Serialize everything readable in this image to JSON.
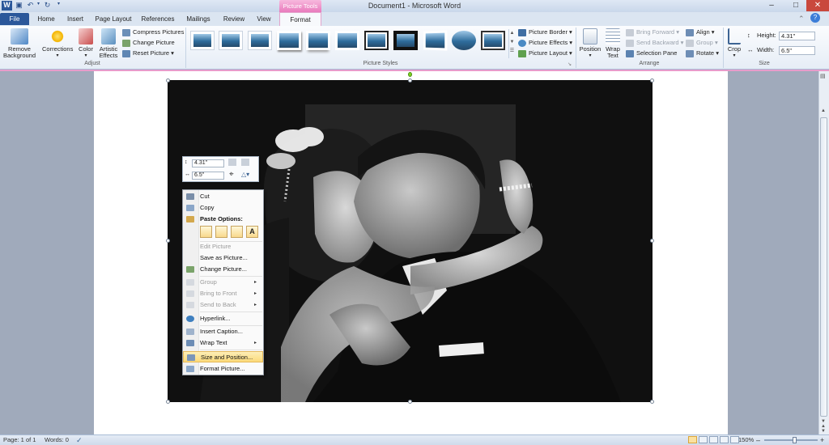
{
  "window": {
    "title": "Document1 - Microsoft Word",
    "contextual_group": "Picture Tools"
  },
  "tabs": [
    "File",
    "Home",
    "Insert",
    "Page Layout",
    "References",
    "Mailings",
    "Review",
    "View",
    "Format"
  ],
  "ribbon": {
    "remove_background": [
      "Remove",
      "Background"
    ],
    "corrections": "Corrections",
    "color": "Color",
    "artistic_effects": [
      "Artistic",
      "Effects"
    ],
    "compress": "Compress Pictures",
    "change": "Change Picture",
    "reset": "Reset Picture",
    "adjust_label": "Adjust",
    "styles_label": "Picture Styles",
    "picture_border": "Picture Border",
    "picture_effects": "Picture Effects",
    "picture_layout": "Picture Layout",
    "position": "Position",
    "wrap_text": [
      "Wrap",
      "Text"
    ],
    "bring_forward": "Bring Forward",
    "send_backward": "Send Backward",
    "selection_pane": "Selection Pane",
    "align": "Align",
    "group": "Group",
    "rotate": "Rotate",
    "arrange_label": "Arrange",
    "crop": "Crop",
    "height_label": "Height:",
    "height_value": "4.31\"",
    "width_label": "Width:",
    "width_value": "6.5\"",
    "size_label": "Size"
  },
  "mini_toolbar": {
    "height": "4.31\"",
    "width": "6.5\""
  },
  "context_menu": {
    "cut": "Cut",
    "copy": "Copy",
    "paste_options": "Paste Options:",
    "paste_icons": [
      "",
      "",
      "",
      "A"
    ],
    "edit_picture": "Edit Picture",
    "save_as_picture": "Save as Picture...",
    "change_picture": "Change Picture...",
    "group": "Group",
    "bring_to_front": "Bring to Front",
    "send_to_back": "Send to Back",
    "hyperlink": "Hyperlink...",
    "insert_caption": "Insert Caption...",
    "wrap_text": "Wrap Text",
    "size_and_position": "Size and Position...",
    "format_picture": "Format Picture..."
  },
  "status": {
    "page": "Page: 1 of 1",
    "words": "Words: 0",
    "zoom": "150%"
  },
  "colors": {
    "file_tab": "#2b579a",
    "picture_tools": "#e97bbd",
    "highlight": "#fbda7a"
  }
}
